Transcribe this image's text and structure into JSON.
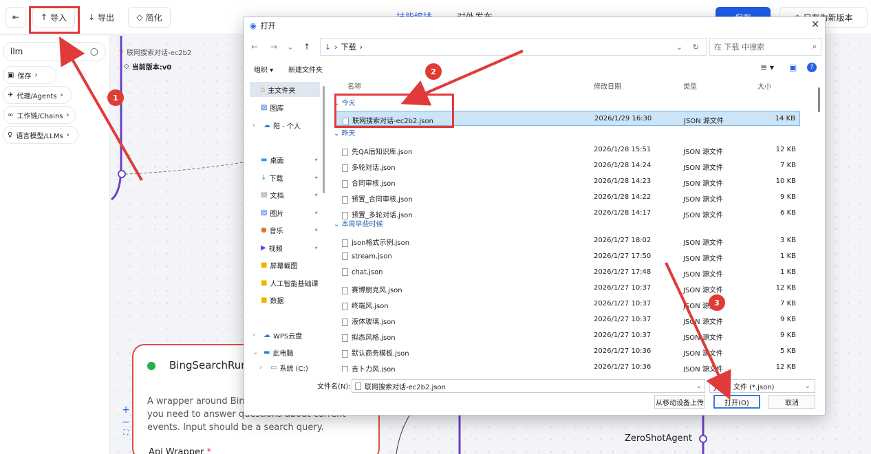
{
  "topbar": {
    "back_icon": "exit-icon",
    "import_label": "导入",
    "export_label": "导出",
    "simplify_label": "简化",
    "tab1": "技能编排",
    "tab2": "对外发布",
    "save_label": "保存",
    "saveas_label": "另存为新版本"
  },
  "sidebar": {
    "search_value": "llm",
    "items": [
      {
        "label": "保存"
      },
      {
        "label": "代理/Agents"
      },
      {
        "label": "工作链/Chains"
      },
      {
        "label": "语言模型/LLMs"
      }
    ]
  },
  "flow": {
    "name": "联网搜索对话-ec2b2",
    "version": "当前版本:v0"
  },
  "node": {
    "title": "BingSearchRun",
    "description": "A wrapper around Bing Search. Useful for when you need to answer questions about current events. Input should be a search query.",
    "param": "Api Wrapper"
  },
  "canvas": {
    "zeroshot_label": "ZeroShotAgent"
  },
  "dialog": {
    "title": "打开",
    "path": "下载",
    "search_placeholder": "在 下载 中搜索",
    "organize": "组织",
    "new_folder": "新建文件夹",
    "nav": [
      {
        "label": "主文件夹"
      },
      {
        "label": "图库"
      },
      {
        "label": "阳 - 个人"
      },
      {
        "label": "桌面"
      },
      {
        "label": "下载"
      },
      {
        "label": "文档"
      },
      {
        "label": "图片"
      },
      {
        "label": "音乐"
      },
      {
        "label": "视频"
      },
      {
        "label": "屏幕截图"
      },
      {
        "label": "人工智能基础课"
      },
      {
        "label": "数据"
      },
      {
        "label": "WPS云盘"
      },
      {
        "label": "此电脑"
      },
      {
        "label": "系统 (C:)"
      }
    ],
    "columns": {
      "name": "名称",
      "date": "修改日期",
      "type": "类型",
      "size": "大小"
    },
    "groups": {
      "today": "今天",
      "yesterday": "昨天",
      "week": "本周早些时候"
    },
    "files": [
      {
        "name": "联网搜索对话-ec2b2.json",
        "date": "2026/1/29 16:30",
        "type": "JSON 源文件",
        "size": "14 KB"
      },
      {
        "name": "先QA后知识库.json",
        "date": "2026/1/28 15:51",
        "type": "JSON 源文件",
        "size": "12 KB"
      },
      {
        "name": "多轮对话.json",
        "date": "2026/1/28 14:24",
        "type": "JSON 源文件",
        "size": "7 KB"
      },
      {
        "name": "合同审核.json",
        "date": "2026/1/28 14:23",
        "type": "JSON 源文件",
        "size": "10 KB"
      },
      {
        "name": "预置_合同审核.json",
        "date": "2026/1/28 14:22",
        "type": "JSON 源文件",
        "size": "9 KB"
      },
      {
        "name": "预置_多轮对话.json",
        "date": "2026/1/28 14:17",
        "type": "JSON 源文件",
        "size": "6 KB"
      },
      {
        "name": "json格式示例.json",
        "date": "2026/1/27 18:02",
        "type": "JSON 源文件",
        "size": "3 KB"
      },
      {
        "name": "stream.json",
        "date": "2026/1/27 17:50",
        "type": "JSON 源文件",
        "size": "1 KB"
      },
      {
        "name": "chat.json",
        "date": "2026/1/27 17:48",
        "type": "JSON 源文件",
        "size": "1 KB"
      },
      {
        "name": "赛博朋克风.json",
        "date": "2026/1/27 10:37",
        "type": "JSON 源文件",
        "size": "12 KB"
      },
      {
        "name": "终端风.json",
        "date": "2026/1/27 10:37",
        "type": "JSON 源文件",
        "size": "7 KB"
      },
      {
        "name": "液体玻璃.json",
        "date": "2026/1/27 10:37",
        "type": "JSON 源文件",
        "size": "9 KB"
      },
      {
        "name": "拟态风格.json",
        "date": "2026/1/27 10:37",
        "type": "JSON 源文件",
        "size": "9 KB"
      },
      {
        "name": "默认商务模板.json",
        "date": "2026/1/27 10:36",
        "type": "JSON 源文件",
        "size": "5 KB"
      },
      {
        "name": "吉卜力风.json",
        "date": "2026/1/27 10:36",
        "type": "JSON 源文件",
        "size": "12 KB"
      }
    ],
    "filename_label": "文件名(N):",
    "filename_value": "联网搜索对话-ec2b2.json",
    "filetype": "JSON 文件 (*.json)",
    "upload_label": "从移动设备上传",
    "open_label": "打开(O)",
    "cancel_label": "取消"
  },
  "annotations": {
    "b1": "1",
    "b2": "2",
    "b3": "3"
  },
  "colors": {
    "accent": "#1e5ce6",
    "highlight": "#e13a3a",
    "node_border": "#e24b4b"
  }
}
